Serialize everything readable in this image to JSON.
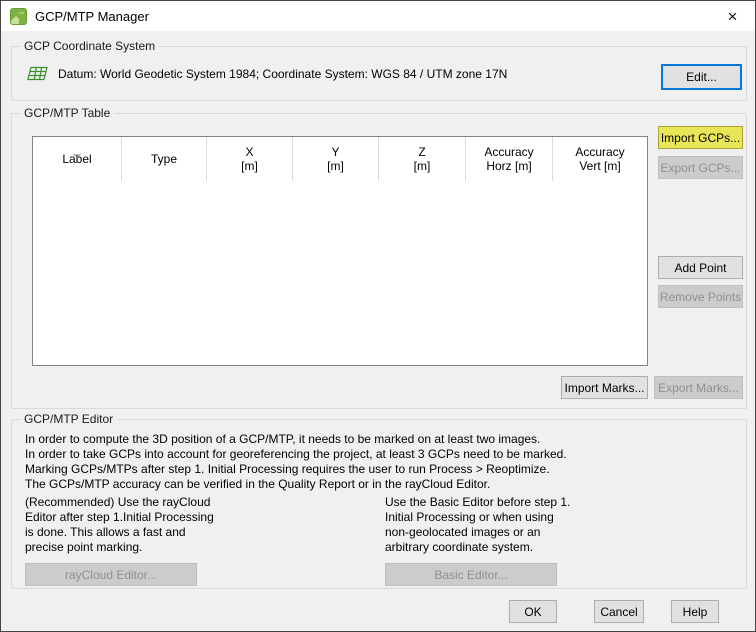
{
  "window": {
    "title": "GCP/MTP Manager"
  },
  "icons": {
    "close": "×"
  },
  "colors": {
    "focus_blue": "#0078d7",
    "highlight_yellow": "#e8e557",
    "grid_icon_green": "#3f8e2e",
    "app_icon_green": "#7cb342",
    "dialog_bg": "#f0f0f0",
    "titlebar_bg": "#ffffff"
  },
  "coordinate_system": {
    "group_label": "GCP Coordinate System",
    "summary": "Datum: World Geodetic System 1984; Coordinate System: WGS 84 / UTM zone 17N",
    "edit_button": "Edit..."
  },
  "table_section": {
    "group_label": "GCP/MTP Table",
    "columns": [
      "Label",
      "Type",
      "X\n[m]",
      "Y\n[m]",
      "Z\n[m]",
      "Accuracy\nHorz [m]",
      "Accuracy\nVert [m]"
    ],
    "rows": [],
    "import_gcps_button": "Import GCPs...",
    "export_gcps_button": "Export GCPs...",
    "add_point_button": "Add Point",
    "remove_points_button": "Remove Points",
    "import_marks_button": "Import Marks...",
    "export_marks_button": "Export Marks..."
  },
  "editor_section": {
    "group_label": "GCP/MTP Editor",
    "info_lines": [
      "In order to compute the 3D position of a GCP/MTP, it needs to be marked on at least two images.",
      "In order to take GCPs into account for georeferencing the project, at least 3 GCPs need to be marked.",
      "Marking GCPs/MTPs after step 1. Initial Processing requires the user to run Process > Reoptimize.",
      "The GCPs/MTP accuracy can be verified in the Quality Report or in the rayCloud Editor."
    ],
    "raycloud_text": "(Recommended) Use the rayCloud\nEditor after step 1.Initial Processing\nis done. This allows a fast and\nprecise point marking.",
    "raycloud_button": "rayCloud Editor...",
    "basic_text": "Use the Basic Editor before step 1.\nInitial Processing or when using\nnon-geolocated images or an\narbitrary coordinate system.",
    "basic_button": "Basic Editor..."
  },
  "footer": {
    "ok_button": "OK",
    "cancel_button": "Cancel",
    "help_button": "Help"
  }
}
